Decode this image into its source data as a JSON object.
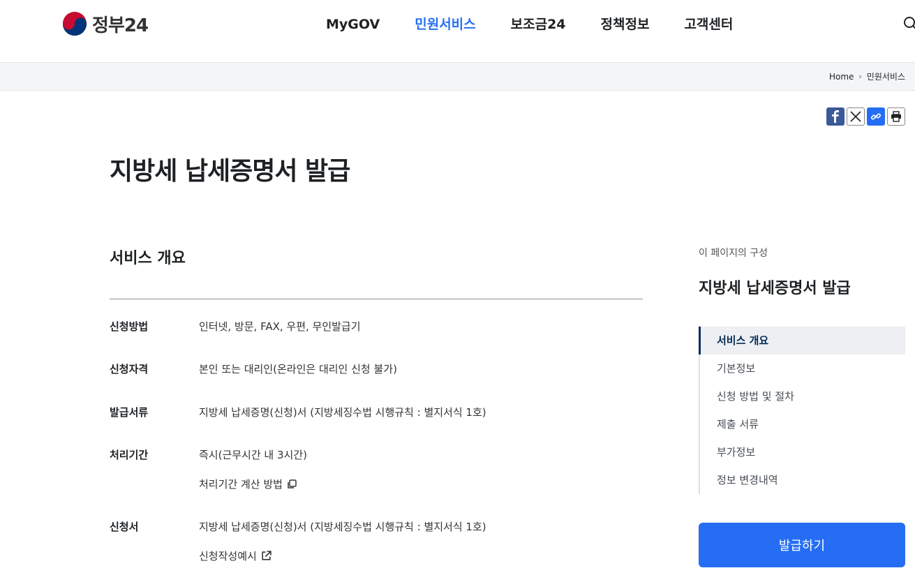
{
  "header": {
    "logo_text": "정부24",
    "nav": [
      "MyGOV",
      "민원서비스",
      "보조금24",
      "정책정보",
      "고객센터"
    ],
    "active_nav": "민원서비스"
  },
  "breadcrumb": {
    "home": "Home",
    "current": "민원서비스"
  },
  "page": {
    "title": "지방세 납세증명서 발급"
  },
  "overview": {
    "title": "서비스 개요",
    "rows": [
      {
        "label": "신청방법",
        "value": "인터넷, 방문, FAX, 우편, 무인발급기"
      },
      {
        "label": "신청자격",
        "value": "본인 또는 대리인(온라인은 대리인 신청 불가)"
      },
      {
        "label": "발급서류",
        "value": "지방세 납세증명(신청)서 (지방세징수법 시행규칙 : 별지서식 1호)"
      },
      {
        "label": "처리기간",
        "value": "즉시(근무시간 내 3시간)",
        "link": "처리기간 계산 방법"
      },
      {
        "label": "신청서",
        "value": "지방세 납세증명(신청)서 (지방세징수법 시행규칙 : 별지서식 1호)",
        "link": "신청작성예시"
      }
    ]
  },
  "toc": {
    "caption": "이 페이지의 구성",
    "title": "지방세 납세증명서 발급",
    "items": [
      "서비스 개요",
      "기본정보",
      "신청 방법 및 절차",
      "제출 서류",
      "부가정보",
      "정보 변경내역"
    ]
  },
  "cta": {
    "label": "발급하기"
  },
  "colors": {
    "primary": "#256ef4",
    "toc_active": "#052b57",
    "facebook": "#3b5998"
  },
  "icons": {
    "search": "search-icon",
    "facebook": "facebook-icon",
    "x": "x-icon",
    "link": "link-icon",
    "print": "print-icon"
  }
}
